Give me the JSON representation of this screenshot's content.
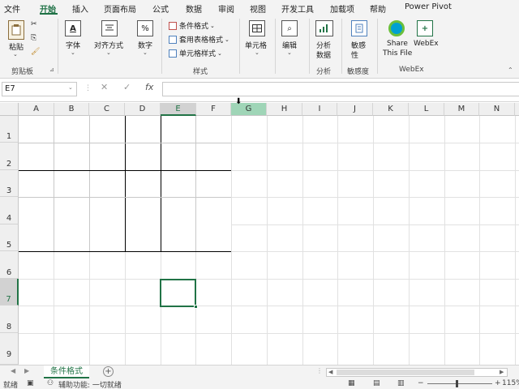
{
  "ribbon_tabs": [
    "文件",
    "开始",
    "插入",
    "页面布局",
    "公式",
    "数据",
    "审阅",
    "视图",
    "开发工具",
    "加载项",
    "帮助",
    "Power Pivot"
  ],
  "active_tab": "开始",
  "clipboard": {
    "paste_label": "粘贴",
    "group_label": "剪贴板"
  },
  "font_group": {
    "label": "字体"
  },
  "align_group": {
    "label": "对齐方式"
  },
  "number_group": {
    "label": "数字",
    "icon_glyph": "%"
  },
  "styles_group": {
    "conditional_format": "条件格式",
    "table_format": "套用表格格式",
    "cell_styles": "单元格样式",
    "group_label": "样式"
  },
  "cells_group": {
    "label": "单元格"
  },
  "editing_group": {
    "label": "编辑"
  },
  "analysis_group": {
    "button_label_1": "分析",
    "button_label_2": "数据",
    "group_label": "分析"
  },
  "sensitivity_group": {
    "button_label_1": "敏感",
    "button_label_2": "性",
    "group_label": "敏感度"
  },
  "webex_group": {
    "share_label_1": "Share",
    "share_label_2": "This File",
    "webex_label": "WebEx",
    "group_label": "WebEx"
  },
  "formula_bar": {
    "name_box": "E7",
    "cancel_glyph": "✕",
    "confirm_glyph": "✓",
    "fx_label": "fx",
    "value": ""
  },
  "columns": [
    "A",
    "B",
    "C",
    "D",
    "E",
    "F",
    "G",
    "H",
    "I",
    "J",
    "K",
    "L",
    "M",
    "N"
  ],
  "rows": [
    "1",
    "2",
    "3",
    "4",
    "5",
    "6",
    "7",
    "8",
    "9"
  ],
  "selected_cell": "E7",
  "sheet_tabs": [
    "条件格式"
  ],
  "add_sheet_glyph": "+",
  "status": {
    "ready": "就绪",
    "accessibility": "辅助功能: 一切就绪",
    "zoom": "115%"
  },
  "colors": {
    "accent": "#217346",
    "ribbon_bg": "#f3f3f3",
    "header_hover": "#9fd5b7"
  }
}
